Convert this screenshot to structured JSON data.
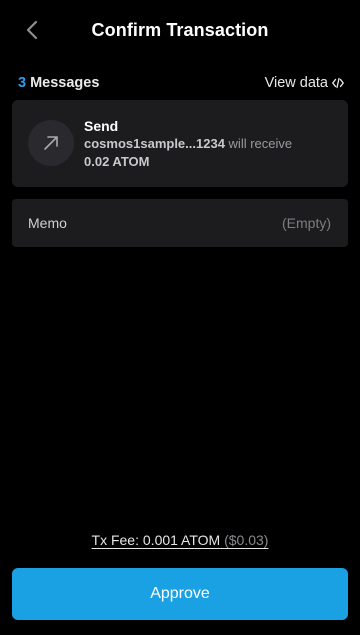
{
  "header": {
    "title": "Confirm Transaction",
    "back_icon": "chevron-left-icon"
  },
  "messages": {
    "count": "3",
    "label": "Messages",
    "view_data_label": "View data",
    "view_data_icon": "code-icon",
    "accent_color": "#2f9ee8"
  },
  "transaction": {
    "type": "Send",
    "icon": "arrow-up-right-icon",
    "recipient": "cosmos1sample...1234",
    "action_text": "will receive",
    "amount": "0.02 ATOM"
  },
  "memo": {
    "label": "Memo",
    "value": "(Empty)"
  },
  "fee": {
    "label": "Tx Fee:",
    "amount": "0.001 ATOM",
    "usd": "($0.03)"
  },
  "approve": {
    "label": "Approve",
    "color": "#1aa1e3"
  }
}
